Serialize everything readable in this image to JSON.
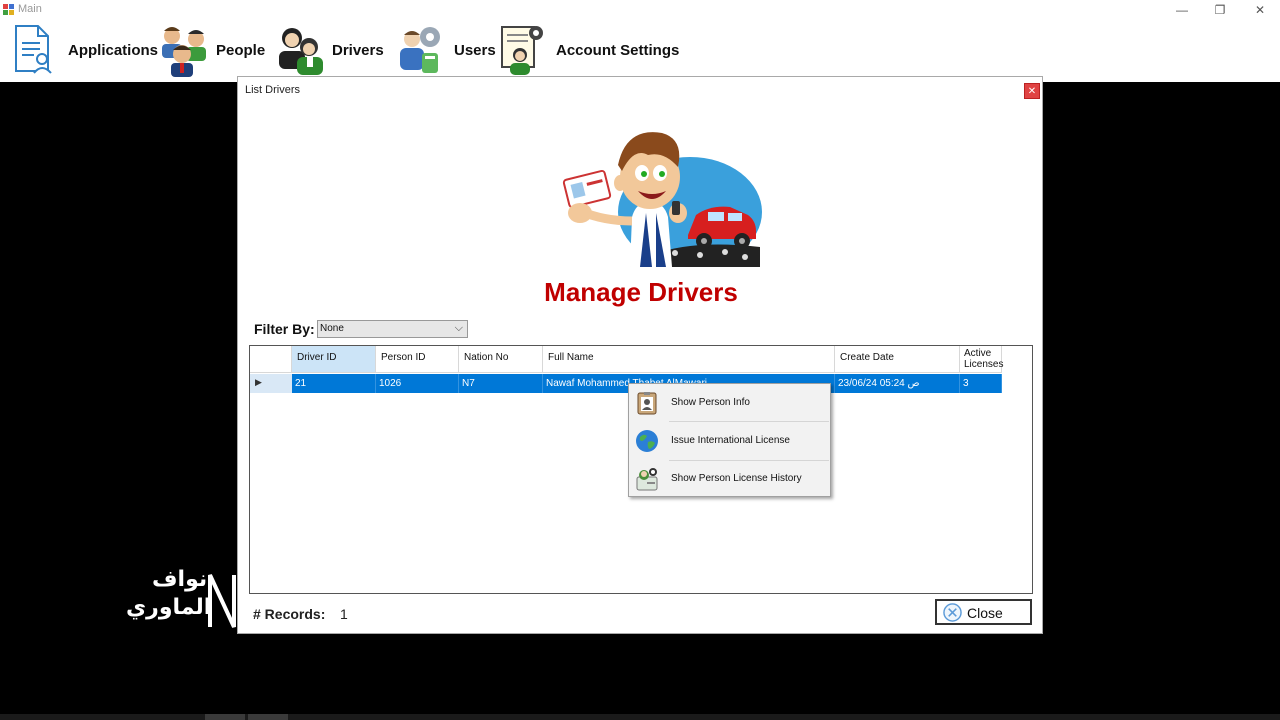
{
  "window": {
    "title": "Main",
    "controls": {
      "minimize": "—",
      "restore": "❐",
      "close": "✕"
    }
  },
  "menu": {
    "items": [
      {
        "label": "Applications",
        "icon": "applications-document-icon"
      },
      {
        "label": "People",
        "icon": "people-group-icon"
      },
      {
        "label": "Drivers",
        "icon": "drivers-icon"
      },
      {
        "label": "Users",
        "icon": "users-settings-icon"
      },
      {
        "label": "Account Settings",
        "icon": "account-settings-icon"
      }
    ]
  },
  "dialog": {
    "title": "List Drivers",
    "close_glyph": "✕",
    "page_title": "Manage Drivers",
    "filter": {
      "label": "Filter By:",
      "selected": "None"
    },
    "grid": {
      "columns": [
        "Driver ID",
        "Person ID",
        "Nation No",
        "Full Name",
        "Create Date",
        "Active\nLicenses"
      ],
      "rows": [
        {
          "driver_id": "21",
          "person_id": "1026",
          "nation_no": "N7",
          "full_name": "Nawaf Mohammed Thabet AlMawari",
          "create_date": "23/06/24 05:24 ص",
          "active_licenses": "3"
        }
      ]
    },
    "context_menu": {
      "items": [
        {
          "label": "Show Person Info",
          "icon": "person-card-icon"
        },
        {
          "label": "Issue International License",
          "icon": "globe-icon"
        },
        {
          "label": "Show Person License History",
          "icon": "license-history-icon"
        }
      ]
    },
    "records": {
      "label": "# Records:",
      "value": "1"
    },
    "close_button": {
      "label": "Close",
      "icon": "close-circle-icon"
    }
  },
  "watermark": {
    "line1": "نواف",
    "line2": "الماوري"
  },
  "colors": {
    "accent": "#0078d7",
    "title_red": "#c00000",
    "background": "#000000"
  }
}
